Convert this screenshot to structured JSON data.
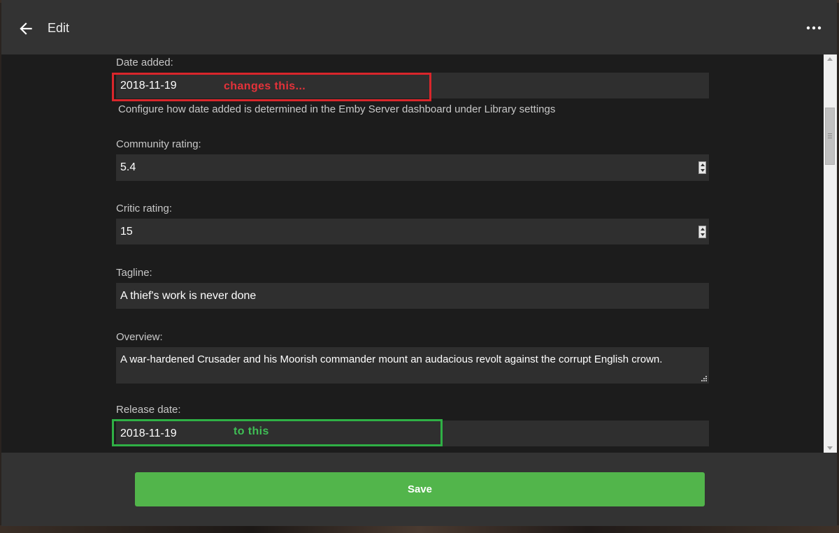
{
  "header": {
    "title": "Edit",
    "back_icon": "arrow-left-icon",
    "more_icon": "more-horizontal-icon"
  },
  "form": {
    "date_added": {
      "label": "Date added:",
      "value": "2018-11-19",
      "help": "Configure how date added is determined in the Emby Server dashboard under Library settings"
    },
    "community_rating": {
      "label": "Community rating:",
      "value": "5.4"
    },
    "critic_rating": {
      "label": "Critic rating:",
      "value": "15"
    },
    "tagline": {
      "label": "Tagline:",
      "value": "A thief's work is never done"
    },
    "overview": {
      "label": "Overview:",
      "value": "A war-hardened Crusader and his Moorish commander mount an audacious revolt against the corrupt English crown."
    },
    "release_date": {
      "label": "Release date:",
      "value": "2018-11-19"
    }
  },
  "annotations": {
    "red_note": "changes this...",
    "green_note": "to this",
    "red_color": "#d9262b",
    "green_color": "#2fb045"
  },
  "footer": {
    "save_label": "Save",
    "save_color": "#52b54b"
  }
}
